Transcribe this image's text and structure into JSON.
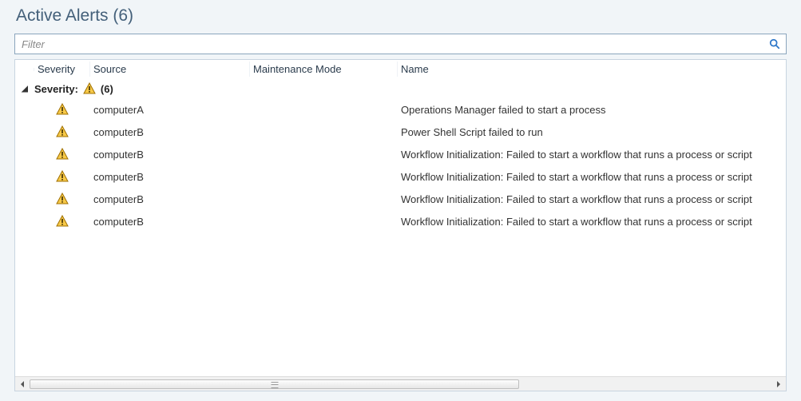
{
  "title": "Active Alerts (6)",
  "filter": {
    "placeholder": "Filter"
  },
  "columns": {
    "severity": "Severity",
    "source": "Source",
    "maintenance_mode": "Maintenance Mode",
    "name": "Name"
  },
  "group": {
    "caret": "◢",
    "label": "Severity:",
    "severity": "Warning",
    "count": "(6)"
  },
  "rows": [
    {
      "severity": "Warning",
      "source": "computerA",
      "maintenance_mode": "",
      "name": "Operations Manager failed to start a process"
    },
    {
      "severity": "Warning",
      "source": "computerB",
      "maintenance_mode": "",
      "name": "Power Shell Script failed to run"
    },
    {
      "severity": "Warning",
      "source": "computerB",
      "maintenance_mode": "",
      "name": "Workflow Initialization: Failed to start a workflow that runs a process or script"
    },
    {
      "severity": "Warning",
      "source": "computerB",
      "maintenance_mode": "",
      "name": "Workflow Initialization: Failed to start a workflow that runs a process or script"
    },
    {
      "severity": "Warning",
      "source": "computerB",
      "maintenance_mode": "",
      "name": "Workflow Initialization: Failed to start a workflow that runs a process or script"
    },
    {
      "severity": "Warning",
      "source": "computerB",
      "maintenance_mode": "",
      "name": "Workflow Initialization: Failed to start a workflow that runs a process or script"
    }
  ]
}
